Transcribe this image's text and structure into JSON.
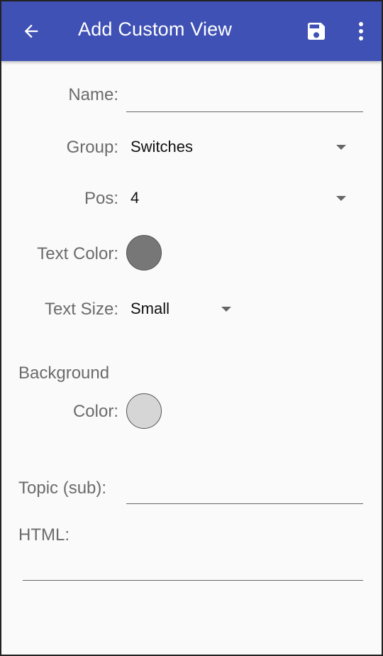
{
  "toolbar": {
    "title": "Add Custom View",
    "back_icon": "arrow-back-icon",
    "save_icon": "save-icon",
    "more_icon": "more-vert-icon",
    "color": "#3f51b5"
  },
  "form": {
    "name_label": "Name:",
    "name_value": "",
    "group_label": "Group:",
    "group_value": "Switches",
    "pos_label": "Pos:",
    "pos_value": "4",
    "text_color_label": "Text Color:",
    "text_color": "#777777",
    "text_size_label": "Text Size:",
    "text_size_value": "Small",
    "background_label_line1": "Background",
    "background_label_line2": "Color:",
    "background_color": "#d6d6d6",
    "topic_label": "Topic (sub):",
    "topic_value": "",
    "html_label": "HTML:",
    "html_value": ""
  }
}
